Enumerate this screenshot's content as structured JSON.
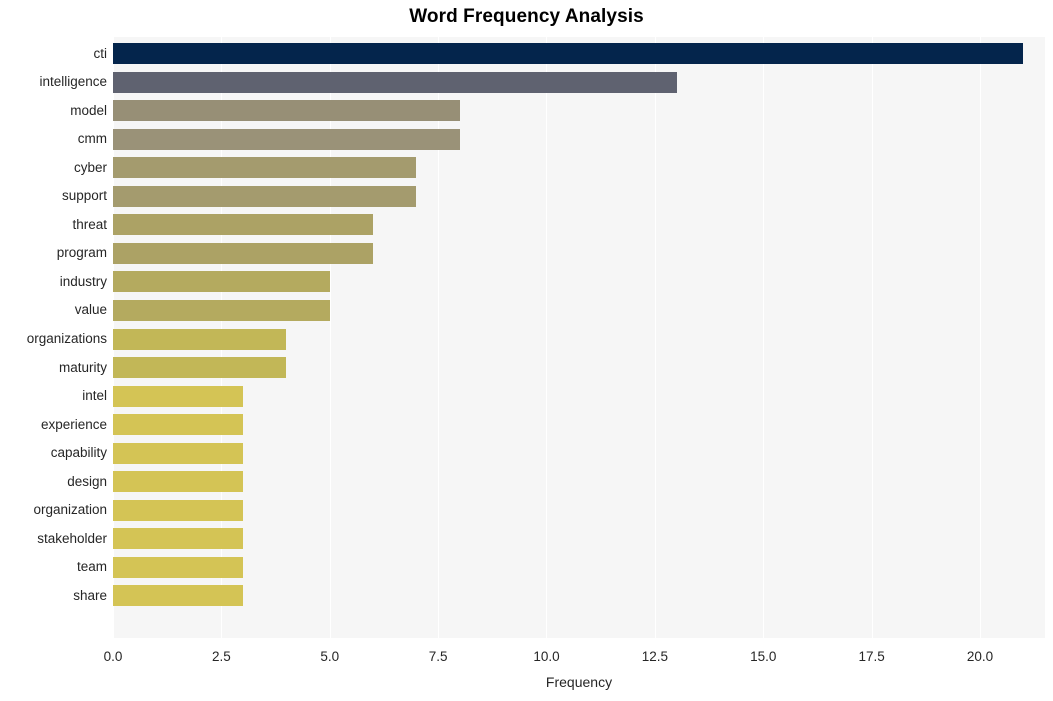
{
  "chart_data": {
    "type": "bar",
    "orientation": "horizontal",
    "title": "Word Frequency Analysis",
    "xlabel": "Frequency",
    "ylabel": "",
    "categories": [
      "cti",
      "intelligence",
      "model",
      "cmm",
      "cyber",
      "support",
      "threat",
      "program",
      "industry",
      "value",
      "organizations",
      "maturity",
      "intel",
      "experience",
      "capability",
      "design",
      "organization",
      "stakeholder",
      "team",
      "share"
    ],
    "values": [
      21,
      13,
      8,
      8,
      7,
      7,
      6,
      6,
      5,
      5,
      4,
      4,
      3,
      3,
      3,
      3,
      3,
      3,
      3,
      3
    ],
    "bar_colors": [
      "#04254c",
      "#5f6270",
      "#978f76",
      "#9a9278",
      "#a49b6e",
      "#a49b6e",
      "#aca265",
      "#aca265",
      "#b4aa5f",
      "#b4aa5f",
      "#c2b757",
      "#c2b757",
      "#d4c455",
      "#d4c455",
      "#d4c455",
      "#d4c455",
      "#d4c455",
      "#d4c455",
      "#d4c455",
      "#d4c455"
    ],
    "xlim": [
      0,
      21.5
    ],
    "xticks": [
      0.0,
      2.5,
      5.0,
      7.5,
      10.0,
      12.5,
      15.0,
      17.5,
      20.0
    ],
    "xtick_labels": [
      "0.0",
      "2.5",
      "5.0",
      "7.5",
      "10.0",
      "12.5",
      "15.0",
      "17.5",
      "20.0"
    ],
    "grid": true,
    "grid_axis": "x",
    "grid_color": "#ffffff",
    "plot_background": "#f6f6f6",
    "figure_background": "#ffffff",
    "legend": null
  }
}
